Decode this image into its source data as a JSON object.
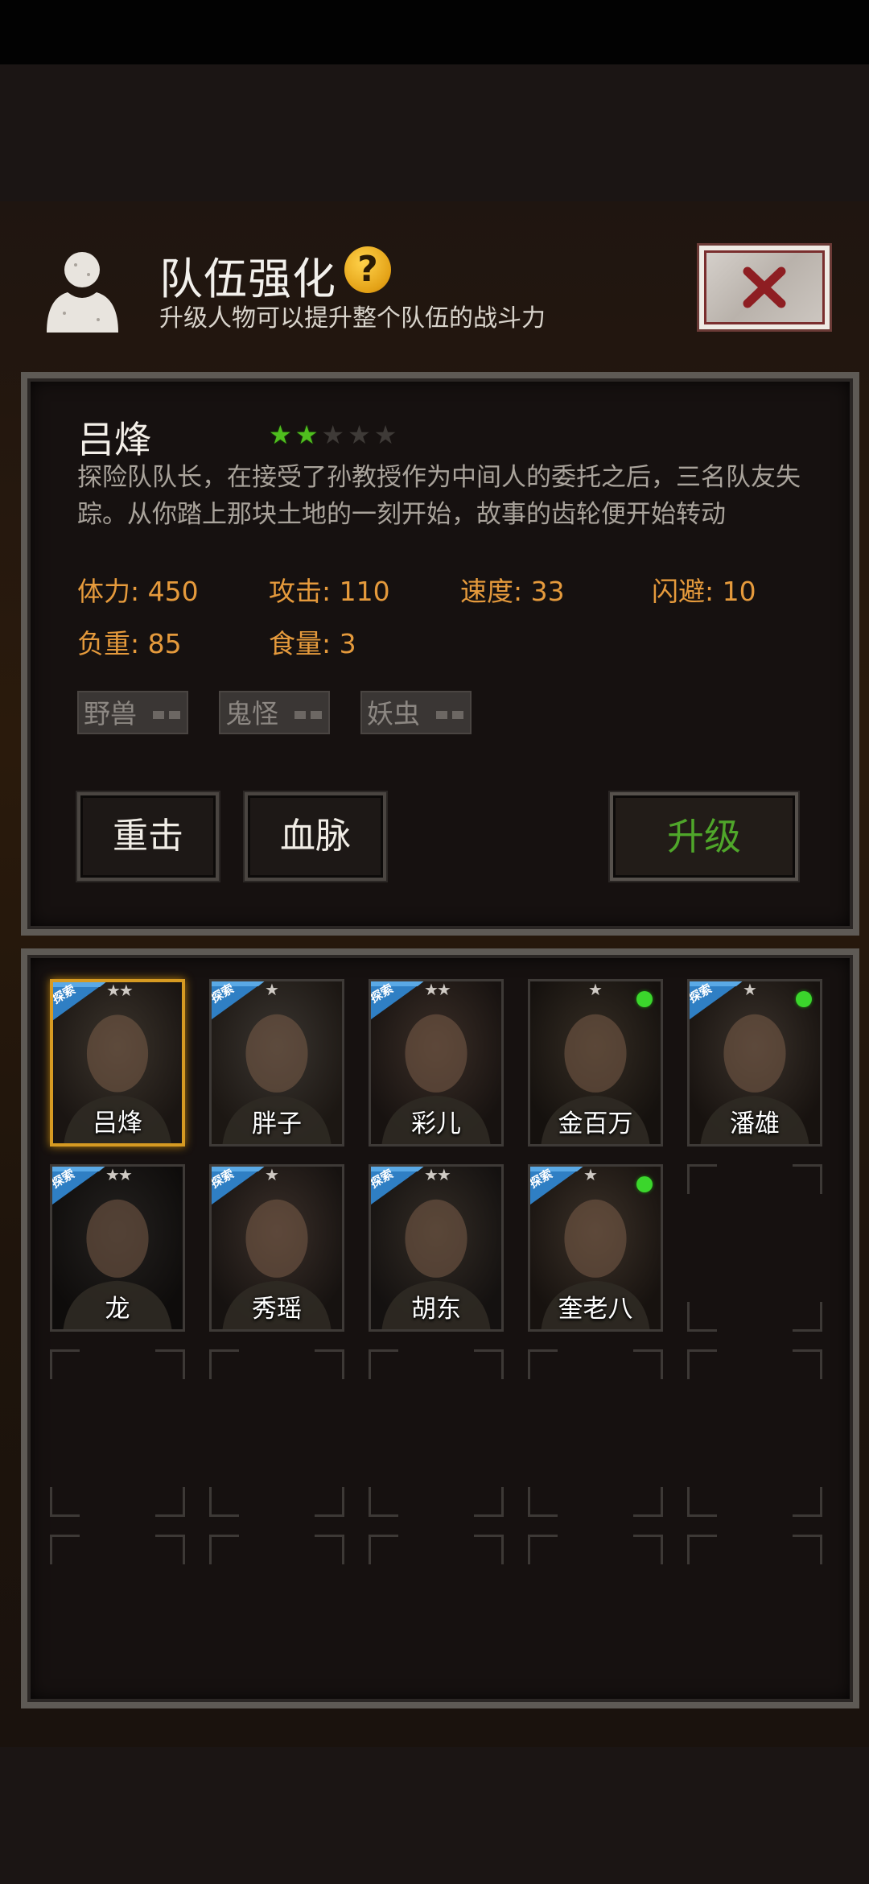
{
  "header": {
    "title": "队伍强化",
    "help_icon": "question-icon",
    "subtitle": "升级人物可以提升整个队伍的战斗力",
    "close_icon": "close-x-icon"
  },
  "character": {
    "name": "吕烽",
    "stars_filled": 2,
    "stars_total": 5,
    "description": "探险队队长，在接受了孙教授作为中间人的委托之后，三名队友失踪。从你踏上那块土地的一刻开始，故事的齿轮便开始转动",
    "stats": {
      "hp": "体力: 450",
      "attack": "攻击: 110",
      "speed": "速度: 33",
      "dodge": "闪避: 10",
      "load": "负重: 85",
      "food": "食量: 3"
    },
    "tags": [
      "野兽",
      "鬼怪",
      "妖虫"
    ],
    "skill_buttons": [
      "重击",
      "血脉"
    ],
    "upgrade_label": "升级"
  },
  "roster": {
    "explore_badge_text": "探索",
    "members": [
      {
        "name": "吕烽",
        "stars": 2,
        "explore": true,
        "online": false,
        "selected": true
      },
      {
        "name": "胖子",
        "stars": 1,
        "explore": true,
        "online": false,
        "selected": false
      },
      {
        "name": "彩儿",
        "stars": 2,
        "explore": true,
        "online": false,
        "selected": false
      },
      {
        "name": "金百万",
        "stars": 1,
        "explore": false,
        "online": true,
        "selected": false
      },
      {
        "name": "潘雄",
        "stars": 1,
        "explore": true,
        "online": true,
        "selected": false
      },
      {
        "name": "龙",
        "stars": 2,
        "explore": true,
        "online": false,
        "selected": false
      },
      {
        "name": "秀瑶",
        "stars": 1,
        "explore": true,
        "online": false,
        "selected": false
      },
      {
        "name": "胡东",
        "stars": 2,
        "explore": true,
        "online": false,
        "selected": false
      },
      {
        "name": "奎老八",
        "stars": 1,
        "explore": true,
        "online": true,
        "selected": false
      }
    ],
    "empty_slots": 6
  },
  "colors": {
    "stat_orange": "#e59a3c",
    "star_green": "#4fbe1e",
    "upgrade_green": "#4fa62a",
    "selected_gold": "#d69a22",
    "online_green": "#3bd62c"
  }
}
